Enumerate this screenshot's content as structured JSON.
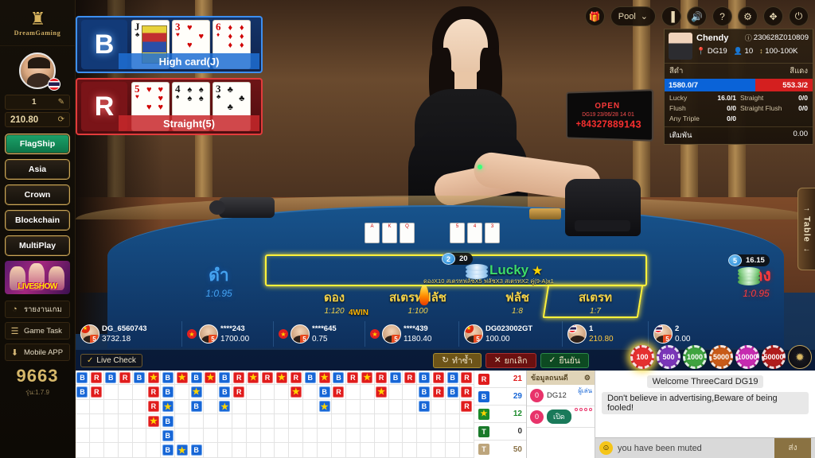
{
  "sidebar": {
    "logo_mark": "♜",
    "brand": "DreamGaming",
    "username": "1",
    "edit_icon": "✎",
    "balance": "210.80",
    "refresh_icon": "⟳",
    "menu": [
      {
        "label": "FlagShip",
        "active": true
      },
      {
        "label": "Asia",
        "active": false
      },
      {
        "label": "Crown",
        "active": false
      },
      {
        "label": "Blockchain",
        "active": false
      },
      {
        "label": "MultiPlay",
        "active": false
      }
    ],
    "liveshow_label": "LIVESHOW",
    "links": [
      {
        "icon": "◔",
        "label": "รายงานเกม"
      },
      {
        "icon": "☰",
        "label": "Game Task"
      },
      {
        "icon": "⬇",
        "label": "Mobile APP"
      }
    ],
    "counter": "9663",
    "version": "รุ่น:1.7.9"
  },
  "toolbar": {
    "gift_icon": "🎁",
    "pool_label": "Pool",
    "pool_caret": "⌄",
    "signal_icon": "▐",
    "volume_icon": "🔊",
    "help_icon": "?",
    "settings_icon": "⚙",
    "fullscreen_icon": "✥",
    "exit_icon": "⏻"
  },
  "results": {
    "blue": {
      "badge": "B",
      "hand_label": "High card(J)",
      "cards": [
        {
          "rank": "J",
          "suit": "♣",
          "color": "black",
          "court": true,
          "pips": 0
        },
        {
          "rank": "3",
          "suit": "♥",
          "color": "red",
          "court": false,
          "pips": 3
        },
        {
          "rank": "6",
          "suit": "♦",
          "color": "red",
          "court": false,
          "pips": 6
        }
      ]
    },
    "red": {
      "badge": "R",
      "hand_label": "Straight(5)",
      "cards": [
        {
          "rank": "5",
          "suit": "♥",
          "color": "red",
          "court": false,
          "pips": 5
        },
        {
          "rank": "4",
          "suit": "♠",
          "color": "black",
          "court": false,
          "pips": 4
        },
        {
          "rank": "3",
          "suit": "♣",
          "color": "black",
          "court": false,
          "pips": 3
        }
      ]
    }
  },
  "open_sign": {
    "title": "OPEN",
    "table_time": "DG19 23/06/28  14 01",
    "phone": "+84327889143"
  },
  "info": {
    "dealer_name": "Chendy",
    "id_icon": "ⓘ",
    "round_id": "230628Z010809",
    "pin_icon": "📍",
    "table": "DG19",
    "person_icon": "👤",
    "players": "10",
    "limit_icon": "↕",
    "limit": "100-100K",
    "col_black": "สีดำ",
    "col_red": "สีแดง",
    "sum_black": "1580.0/7",
    "sum_red": "553.3/2",
    "side_bets": [
      {
        "n1": "Lucky",
        "v1": "16.0/1",
        "n2": "Straight",
        "v2": "0/0"
      },
      {
        "n1": "Flush",
        "v1": "0/0",
        "n2": "Straight Flush",
        "v2": "0/0"
      },
      {
        "n1": "Any Triple",
        "v1": "0/0",
        "n2": "",
        "v2": ""
      }
    ],
    "foot_label": "เติมพัน",
    "foot_value": "0.00"
  },
  "betting": {
    "black": {
      "title": "ดำ",
      "odds": "1:0.95"
    },
    "red": {
      "title": "แดง",
      "odds": "1:0.95"
    },
    "lucky": {
      "title": "Lucky",
      "star": "★",
      "sub": "ดองX10 สเตรทฟลัชX5 ฟลัชX3 สเตรทX2  คู่(9-A)x1"
    },
    "zones": [
      {
        "title": "ดอง",
        "odds": "1:120"
      },
      {
        "title": "สเตรทฟลัช",
        "odds": "1:100"
      },
      {
        "title": "ฟลัช",
        "odds": "1:8"
      },
      {
        "title": "สเตรท",
        "odds": "1:7"
      }
    ],
    "chips_on_table": [
      {
        "count": "2",
        "amount": "20",
        "where": "lucky-top"
      },
      {
        "count": "5",
        "amount": "16.15",
        "where": "red-top"
      }
    ],
    "win_flag": "4WIN"
  },
  "players": [
    {
      "name": "DG_6560743",
      "balance": "3732.18",
      "flag": "cn",
      "star": true,
      "lvl": "5"
    },
    {
      "name": "****243",
      "balance": "1700.00",
      "flag": "cn",
      "star": true,
      "lvl": "5"
    },
    {
      "name": "****645",
      "balance": "0.75",
      "flag": "none",
      "star": true,
      "lvl": "5"
    },
    {
      "name": "****439",
      "balance": "1180.40",
      "flag": "none",
      "star": true,
      "lvl": "5"
    },
    {
      "name": "DG023002GT",
      "balance": "100.00",
      "flag": "cn",
      "star": false,
      "lvl": "5"
    },
    {
      "name": "1",
      "balance": "210.80",
      "flag": "th",
      "star": false,
      "lvl": "",
      "self": true
    },
    {
      "name": "2",
      "balance": "0.00",
      "flag": "th",
      "star": false,
      "lvl": "5"
    }
  ],
  "actions": {
    "live_check": "Live Check",
    "shield_icon": "✓",
    "repeat": {
      "icon": "↻",
      "label": "ทำซ้ำ"
    },
    "cancel": {
      "icon": "✕",
      "label": "ยกเลิก"
    },
    "confirm": {
      "icon": "✓",
      "label": "ยืนยัน"
    }
  },
  "chip_selector": {
    "chips": [
      "100",
      "500",
      "1000",
      "5000",
      "10000",
      "50000"
    ],
    "selected": "100",
    "more_icon": "✹"
  },
  "roadmap": {
    "columns": 28,
    "rows": 6,
    "cells": [
      [
        "B",
        "B",
        "",
        "",
        "",
        ""
      ],
      [
        "R",
        "R",
        "",
        "",
        "",
        ""
      ],
      [
        "B",
        "",
        "",
        "",
        "",
        ""
      ],
      [
        "R",
        "",
        "",
        "",
        "",
        ""
      ],
      [
        "B",
        "",
        "",
        "",
        "",
        ""
      ],
      [
        "S",
        "R",
        "R",
        "S",
        "",
        ""
      ],
      [
        "B",
        "B",
        "SB",
        "B",
        "B",
        "B"
      ],
      [
        "S",
        "",
        "",
        "",
        "",
        "SB"
      ],
      [
        "B",
        "SB",
        "B",
        "",
        "",
        "B"
      ],
      [
        "S",
        "",
        "",
        "",
        "",
        ""
      ],
      [
        "B",
        "B",
        "SB",
        "",
        "",
        ""
      ],
      [
        "R",
        "R",
        "",
        "",
        "",
        ""
      ],
      [
        "S",
        "",
        "",
        "",
        "",
        ""
      ],
      [
        "R",
        "",
        "",
        "",
        "",
        ""
      ],
      [
        "S",
        "",
        "",
        "",
        "",
        ""
      ],
      [
        "R",
        "S",
        "",
        "",
        "",
        ""
      ],
      [
        "B",
        "",
        "",
        "",
        "",
        ""
      ],
      [
        "S",
        "B",
        "SB",
        "",
        "",
        ""
      ],
      [
        "B",
        "R",
        "",
        "",
        "",
        ""
      ],
      [
        "R",
        "",
        "",
        "",
        "",
        ""
      ],
      [
        "S",
        "",
        "",
        "",
        "",
        ""
      ],
      [
        "R",
        "S",
        "",
        "",
        "",
        ""
      ],
      [
        "B",
        "",
        "",
        "",
        "",
        ""
      ],
      [
        "R",
        "",
        "",
        "",
        "",
        ""
      ],
      [
        "B",
        "B",
        "B",
        "",
        "",
        ""
      ],
      [
        "R",
        "R",
        "",
        "",
        "",
        ""
      ],
      [
        "B",
        "B",
        "",
        "",
        "",
        ""
      ],
      [
        "R",
        "R",
        "R",
        "",
        "",
        ""
      ]
    ]
  },
  "stats": [
    {
      "icon": "R",
      "type": "R",
      "value": "21"
    },
    {
      "icon": "B",
      "type": "B",
      "value": "29"
    },
    {
      "icon": "★",
      "type": "S",
      "value": "12"
    },
    {
      "icon": "T",
      "type": "T",
      "value": "0"
    },
    {
      "icon": "T",
      "type": "T2",
      "value": "50"
    }
  ],
  "chat_side": {
    "header": "ข้อมูลถนนดี",
    "gear_icon": "⚙",
    "rows": [
      {
        "chip": "0",
        "name": "DG12",
        "tag": "ผู้เล่น"
      },
      {
        "chip": "0",
        "name": "เปิด",
        "tag": ""
      }
    ]
  },
  "chat": {
    "messages": [
      {
        "text": "Welcome ThreeCard DG19",
        "align": "center"
      },
      {
        "text": "Don't believe in advertising,Beware of being fooled!",
        "align": "left"
      }
    ],
    "emoji_icon": "☺",
    "input_value": "you have been muted",
    "send_label": "ส่ง"
  },
  "table_tab": {
    "label": "Table",
    "up_icon": "→",
    "down_icon": "←"
  }
}
